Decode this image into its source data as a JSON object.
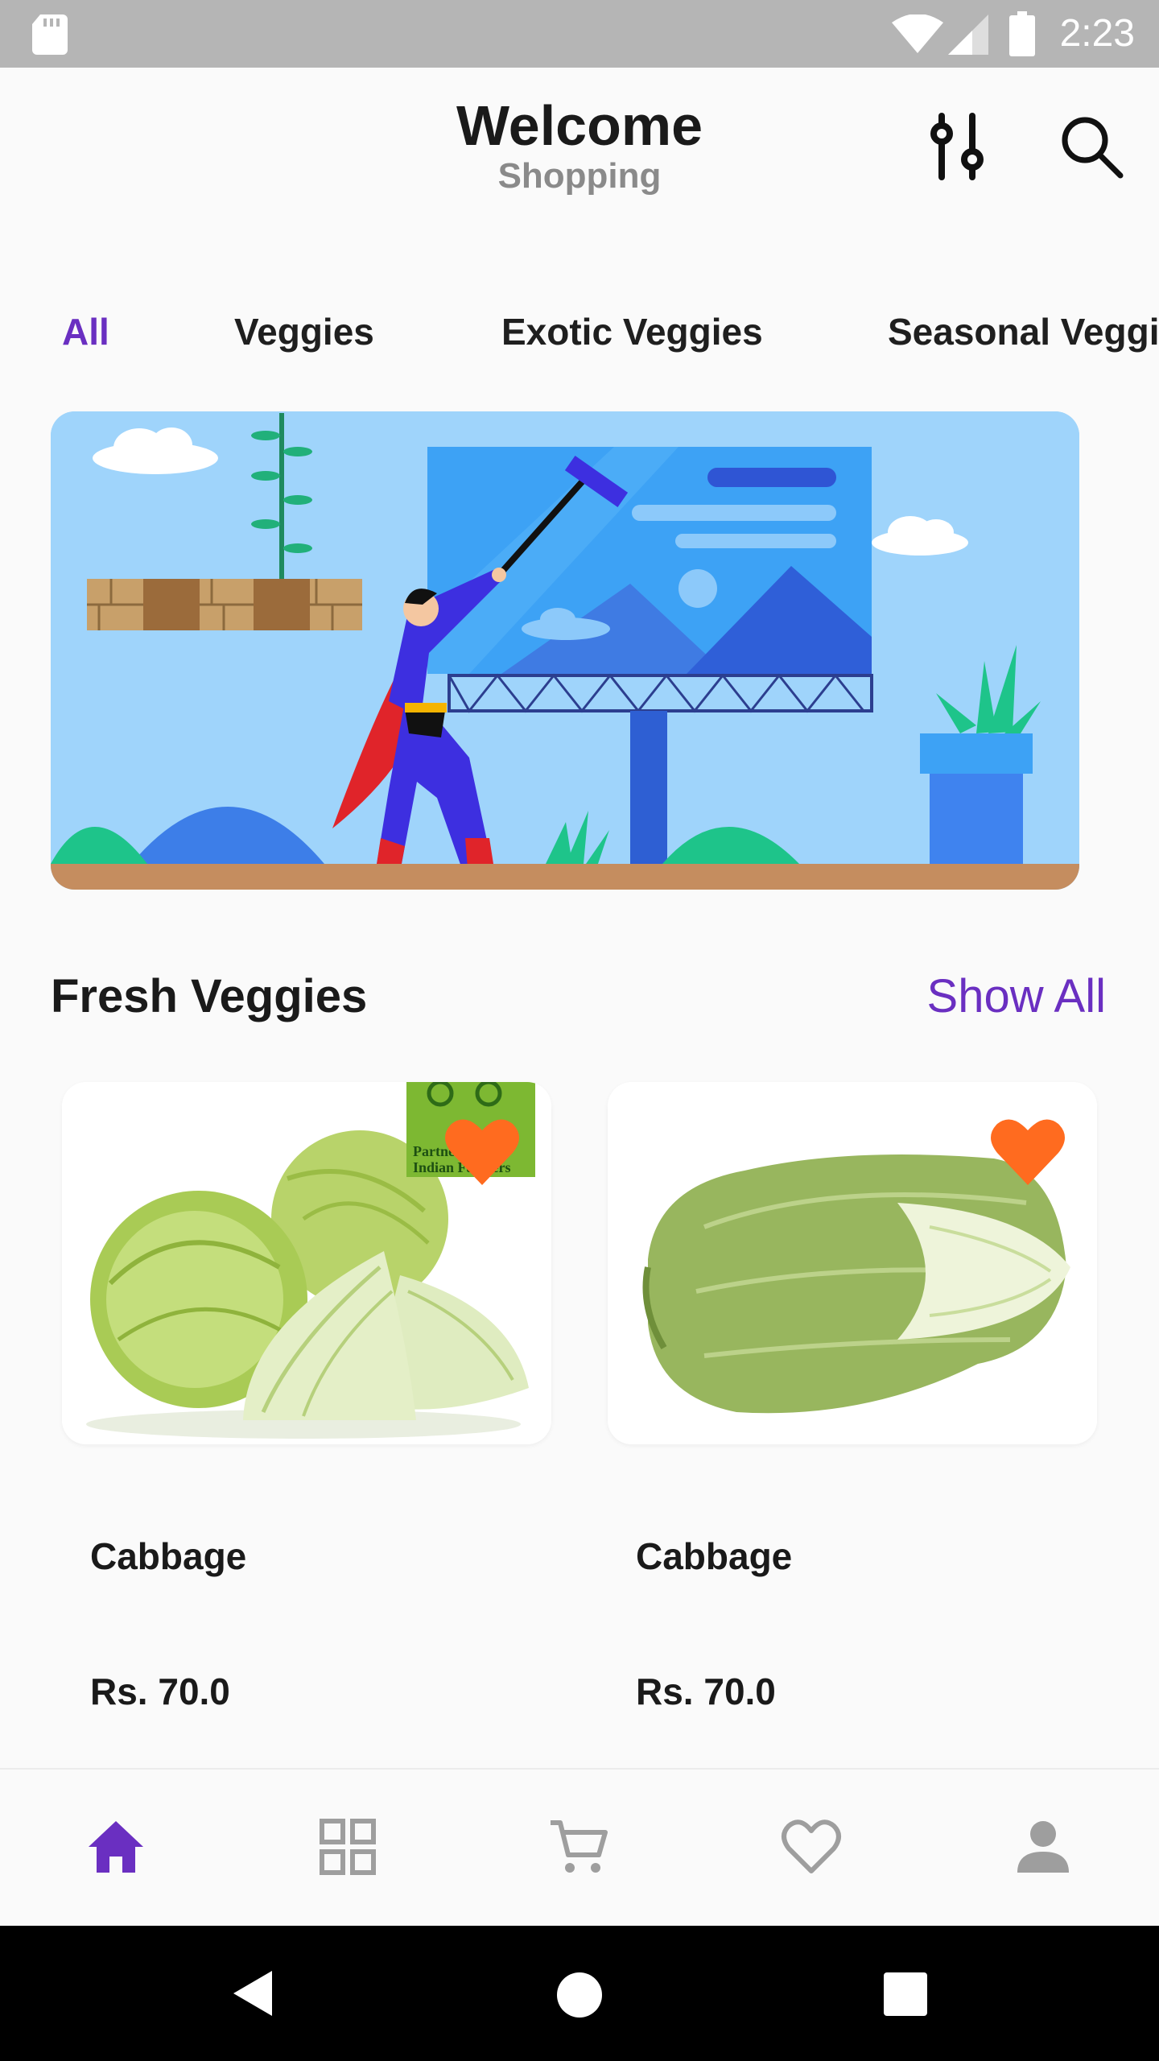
{
  "status_bar": {
    "time": "2:23",
    "icons": [
      "sd-card-icon",
      "wifi-icon",
      "signal-icon",
      "battery-icon"
    ]
  },
  "header": {
    "title": "Welcome",
    "subtitle": "Shopping",
    "icons": [
      "filter-sliders-icon",
      "search-icon"
    ]
  },
  "tabs": [
    {
      "label": "All",
      "active": true
    },
    {
      "label": "Veggies",
      "active": false
    },
    {
      "label": "Exotic Veggies",
      "active": false
    },
    {
      "label": "Seasonal Veggies",
      "active": false
    }
  ],
  "banner": {
    "badge_text": "Partner with Indian Farmers"
  },
  "section": {
    "title": "Fresh Veggies",
    "action": "Show All"
  },
  "products": [
    {
      "name": "Cabbage",
      "price": "Rs. 70.0",
      "favorite": true
    },
    {
      "name": "Cabbage",
      "price": "Rs. 70.0",
      "favorite": true
    }
  ],
  "bottom_nav": {
    "items": [
      {
        "icon": "home-icon",
        "active": true
      },
      {
        "icon": "grid-icon",
        "active": false
      },
      {
        "icon": "cart-icon",
        "active": false
      },
      {
        "icon": "heart-outline-icon",
        "active": false
      },
      {
        "icon": "person-icon",
        "active": false
      }
    ]
  },
  "colors": {
    "accent": "#6a2fc1",
    "heart": "#ff6b1f",
    "inactive_icon": "#9e9e9e",
    "status_bar": "#b5b5b5"
  }
}
